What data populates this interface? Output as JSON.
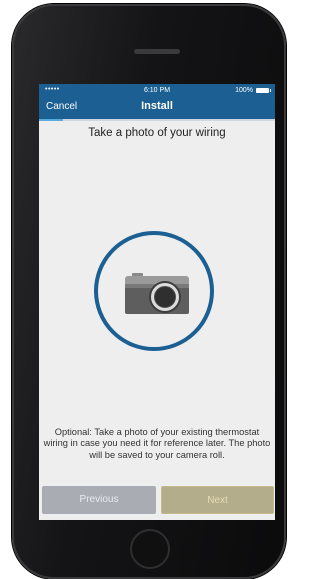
{
  "status_bar": {
    "signal": "•••••",
    "time": "6:10 PM",
    "battery": "100%"
  },
  "nav": {
    "cancel_label": "Cancel",
    "title": "Install"
  },
  "progress": {
    "fraction": 0.1
  },
  "main": {
    "heading": "Take a photo of your wiring",
    "description": "Optional: Take a photo of your existing thermostat wiring in case you need it for reference later. The photo will be saved to your camera roll.",
    "icon": "camera-icon"
  },
  "buttons": {
    "previous_label": "Previous",
    "next_label": "Next"
  },
  "colors": {
    "brand": "#1b5f93",
    "progress": "#5aa9dc",
    "previous_bg": "#a9adb3",
    "next_bg": "#b3ad8c"
  }
}
